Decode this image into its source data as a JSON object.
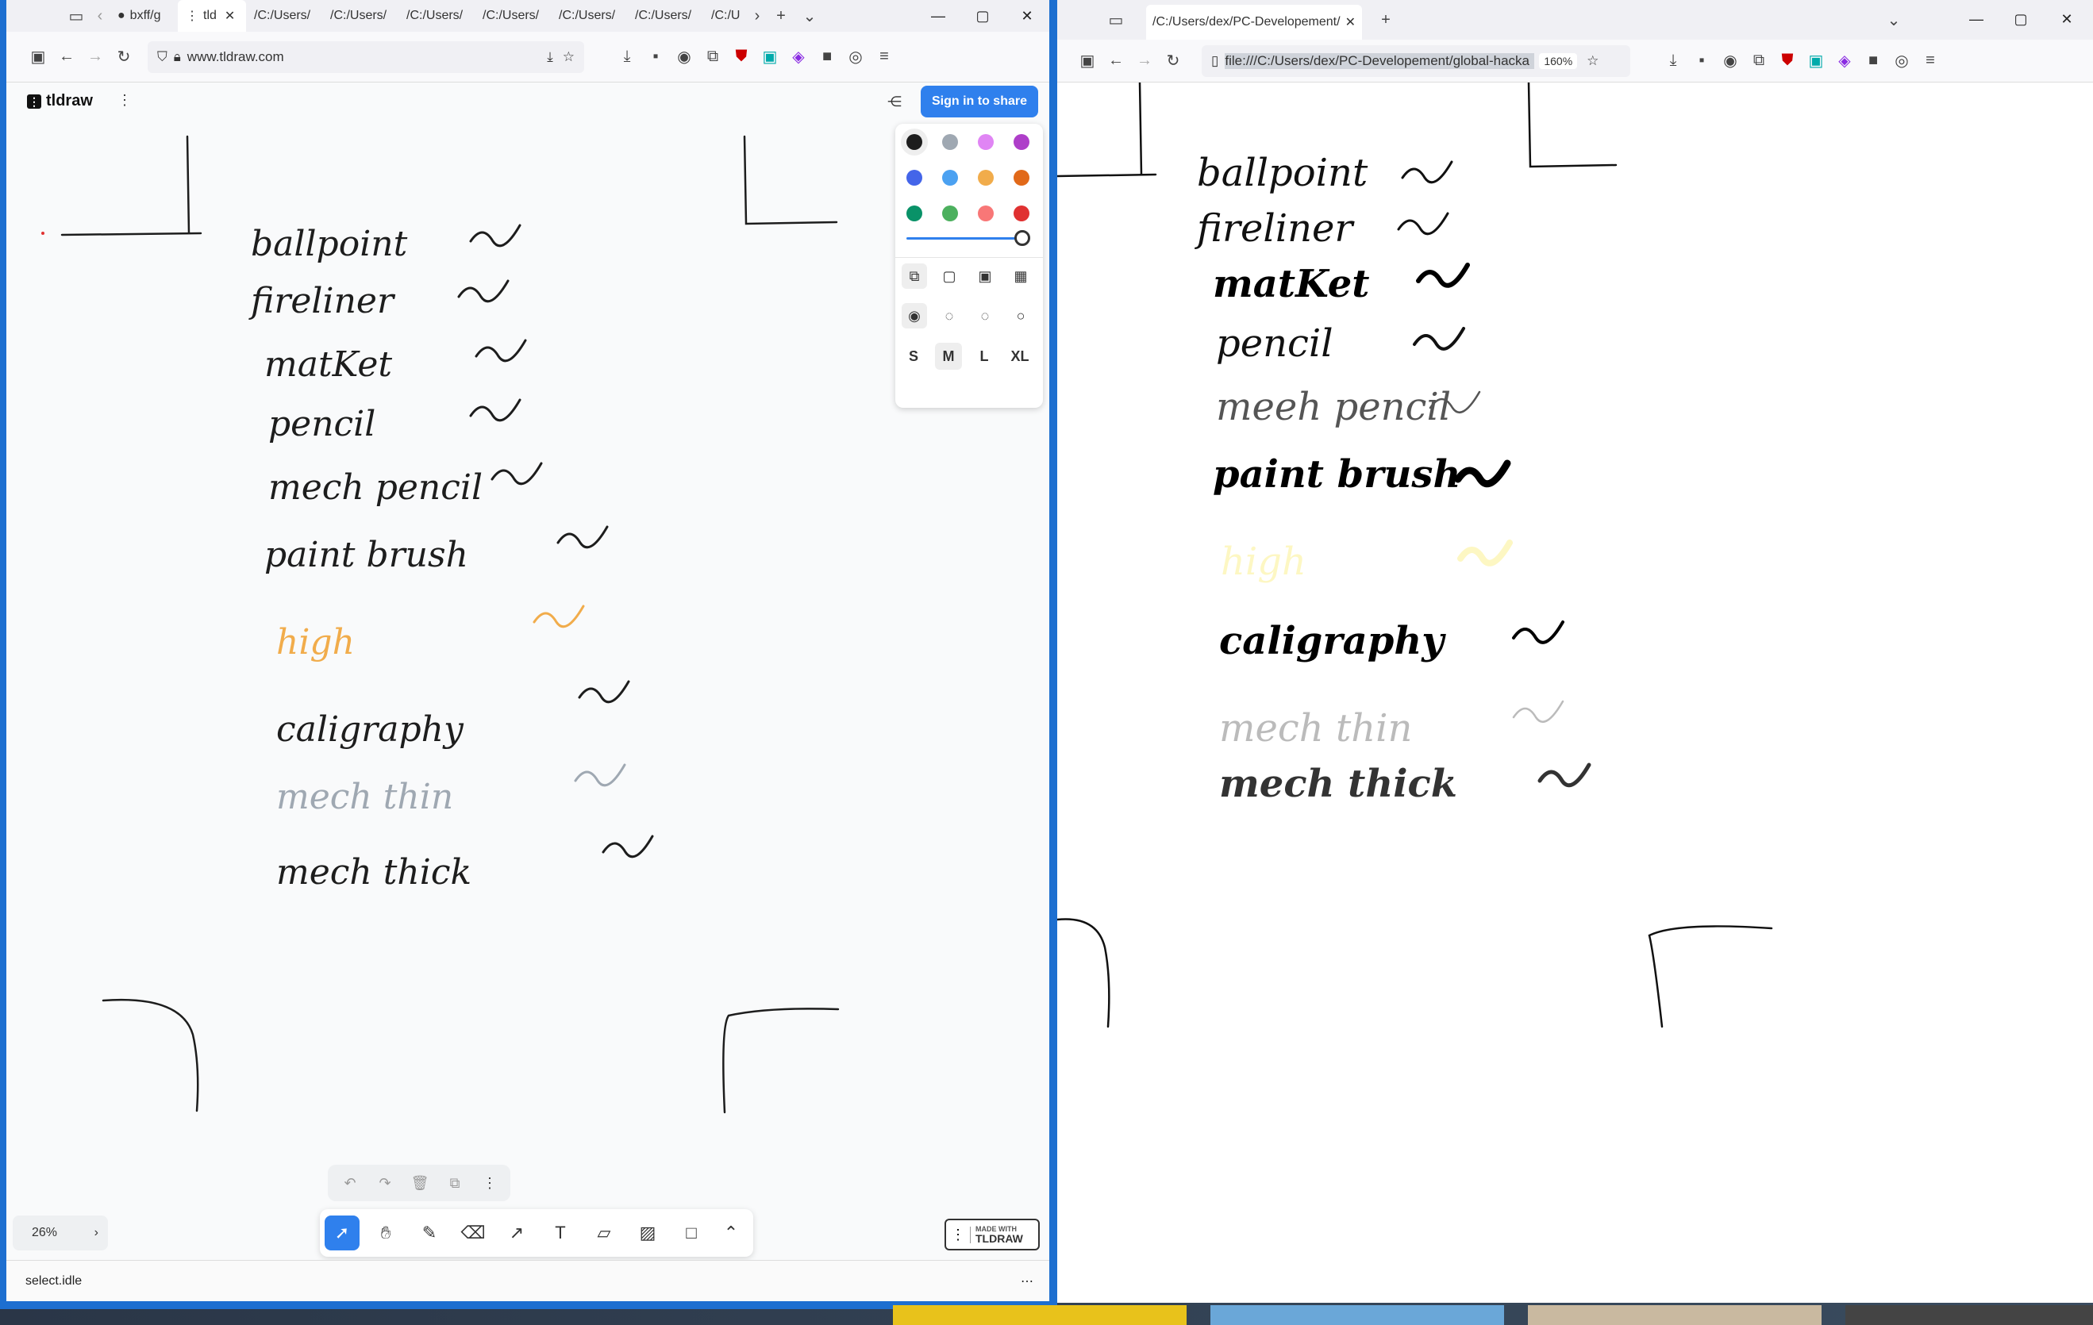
{
  "left_window": {
    "tabs": [
      {
        "label": "bxff/g"
      },
      {
        "label": "tld"
      },
      {
        "label": "/C:/Users/"
      },
      {
        "label": "/C:/Users/"
      },
      {
        "label": "/C:/Users/"
      },
      {
        "label": "/C:/Users/"
      },
      {
        "label": "/C:/Users/"
      },
      {
        "label": "/C:/Users/"
      },
      {
        "label": "/C:/U"
      }
    ],
    "url": "www.tldraw.com",
    "app_name": "tldraw",
    "sign_in_label": "Sign in to share",
    "sizes": [
      "S",
      "M",
      "L",
      "XL"
    ],
    "selected_size": "M",
    "zoom": "26%",
    "status": "select.idle",
    "made_with_top": "MADE WITH",
    "made_with_bottom": "TLDRAW",
    "colors": [
      "#1d1d1d",
      "#9fa8b2",
      "#e085f4",
      "#ae3ec9",
      "#4465e9",
      "#4ba1f1",
      "#f1ac4b",
      "#e16919",
      "#099268",
      "#4cb05e",
      "#f87777",
      "#e03131"
    ],
    "drawn_labels": [
      {
        "text": "ballpoint",
        "color": "#1d1d1d"
      },
      {
        "text": "fireliner",
        "color": "#1d1d1d"
      },
      {
        "text": "matKet",
        "color": "#1d1d1d"
      },
      {
        "text": "pencil",
        "color": "#1d1d1d"
      },
      {
        "text": "mech pencil",
        "color": "#1d1d1d"
      },
      {
        "text": "paint brush",
        "color": "#1d1d1d"
      },
      {
        "text": "high",
        "color": "#f1ac4b"
      },
      {
        "text": "caligraphy",
        "color": "#1d1d1d"
      },
      {
        "text": "mech thin",
        "color": "#9fa8b2"
      },
      {
        "text": "mech thick",
        "color": "#1d1d1d"
      }
    ]
  },
  "right_window": {
    "tab_label": "/C:/Users/dex/PC-Developement/gl",
    "url": "file:///C:/Users/dex/PC-Developement/global-hacka",
    "zoom": "160%",
    "drawn_labels": [
      {
        "text": "ballpoint",
        "color": "#111111"
      },
      {
        "text": "fireliner",
        "color": "#111111"
      },
      {
        "text": "matKet",
        "color": "#000000"
      },
      {
        "text": "pencil",
        "color": "#111111"
      },
      {
        "text": "meeh pencil",
        "color": "#555555"
      },
      {
        "text": "paint brush",
        "color": "#000000"
      },
      {
        "text": "high",
        "color": "#fdf7c3"
      },
      {
        "text": "caligraphy",
        "color": "#000000"
      },
      {
        "text": "mech thin",
        "color": "#bbbbbb"
      },
      {
        "text": "mech thick",
        "color": "#333333"
      }
    ]
  }
}
